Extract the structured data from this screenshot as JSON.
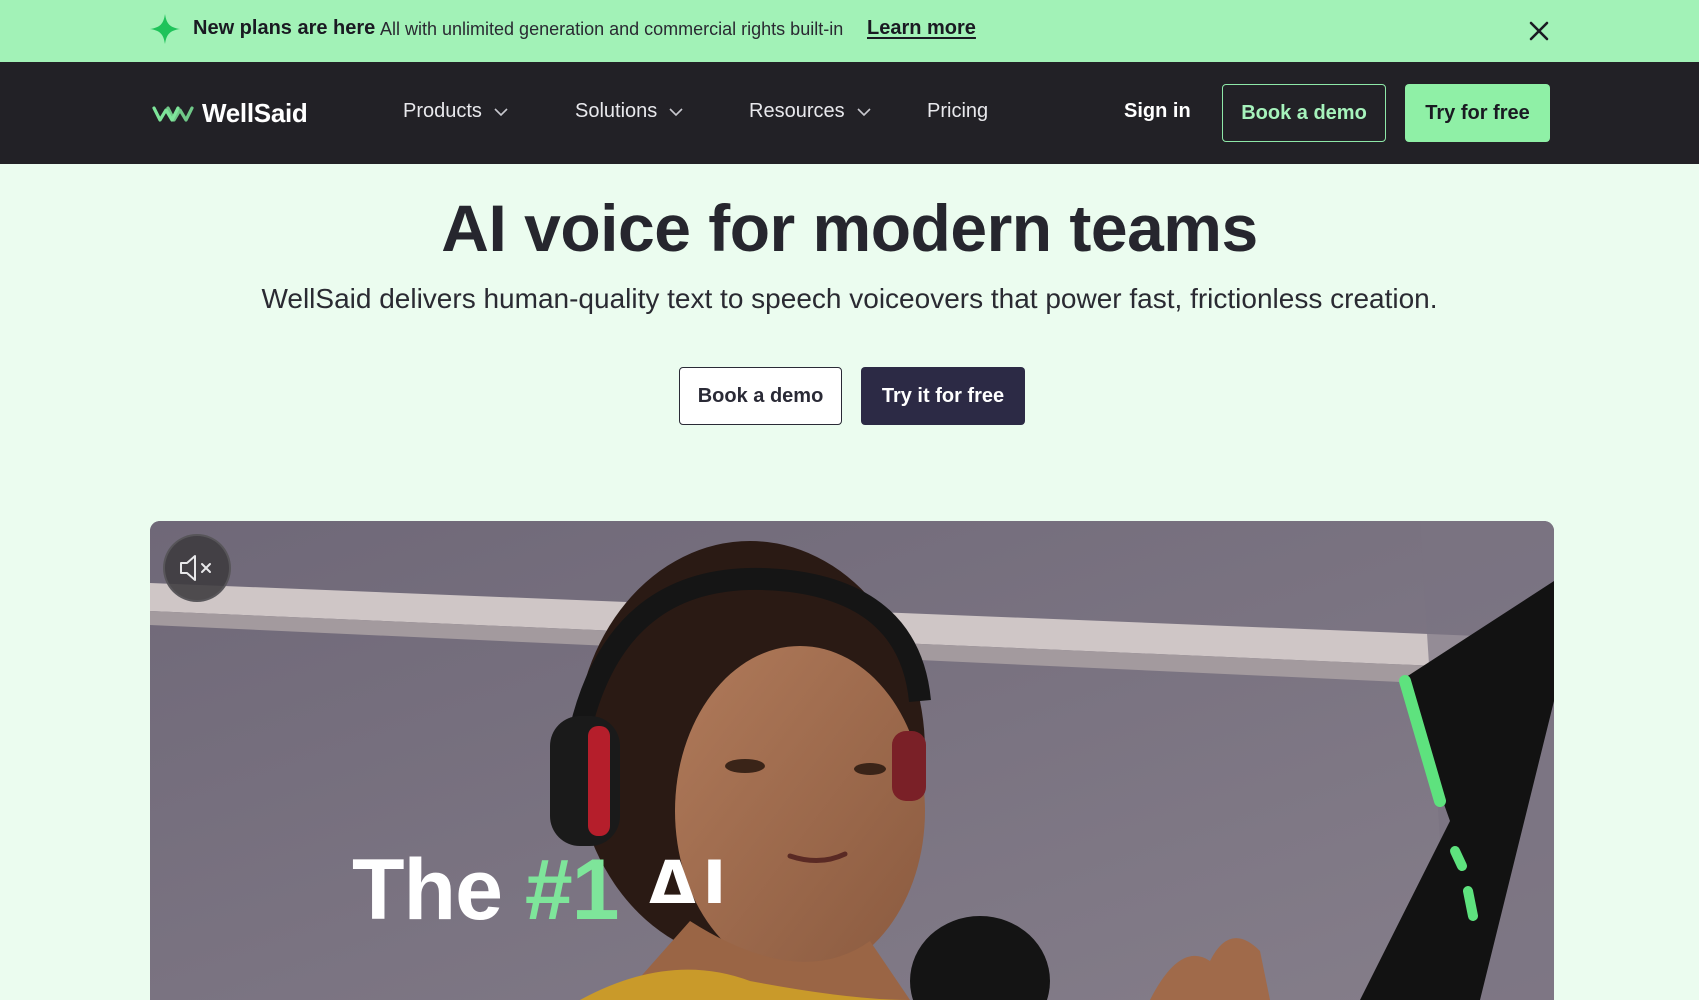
{
  "announcement": {
    "lead": "New plans are here",
    "description": "All with unlimited generation and commercial rights built-in",
    "link_label": "Learn more",
    "icons": {
      "spark": "sparkle-icon",
      "close": "close-icon"
    }
  },
  "nav": {
    "logo_text": "WellSaid",
    "items": [
      {
        "label": "Products",
        "has_dropdown": true
      },
      {
        "label": "Solutions",
        "has_dropdown": true
      },
      {
        "label": "Resources",
        "has_dropdown": true
      },
      {
        "label": "Pricing",
        "has_dropdown": false
      }
    ],
    "sign_in": "Sign in",
    "book_demo": "Book a demo",
    "try_free": "Try for free"
  },
  "hero": {
    "title": "AI voice for modern teams",
    "subtitle": "WellSaid delivers human-quality text to speech voiceovers that power fast, frictionless creation.",
    "book_demo": "Book a demo",
    "try_free": "Try it for free"
  },
  "video": {
    "overlay_the": "The",
    "overlay_rank": "#1",
    "overlay_tail": "AI",
    "mute_icon": "muted-speaker-icon"
  },
  "colors": {
    "announce_bg": "#a2f2b7",
    "nav_bg": "#222126",
    "accent_green": "#8ff0a6",
    "hero_bg": "#ebfcef",
    "primary_dark": "#2c2a45"
  }
}
